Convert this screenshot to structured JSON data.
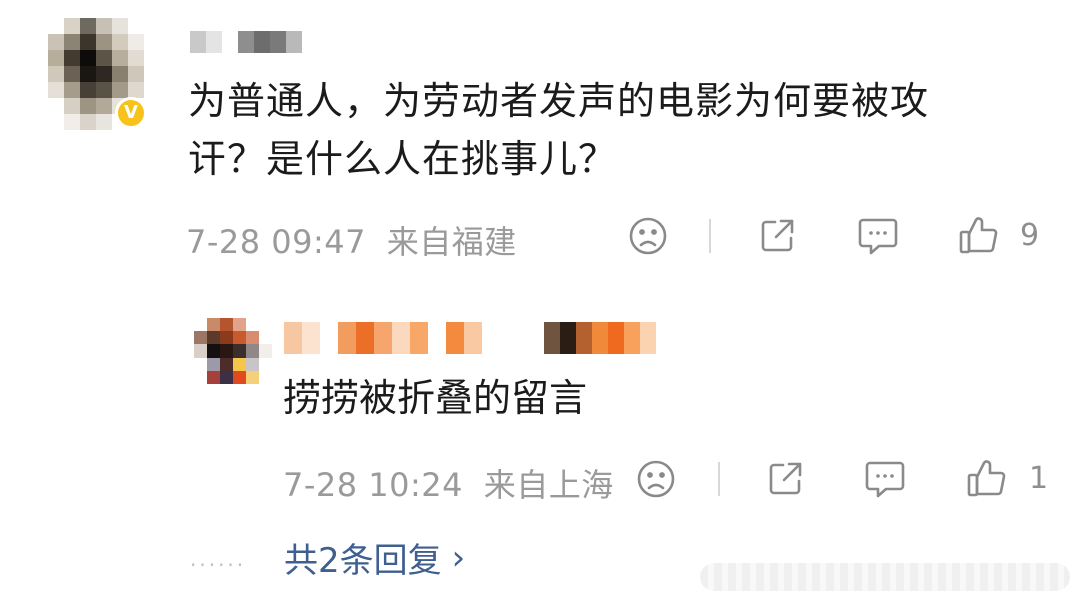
{
  "comment": {
    "text_line1": "为普通人，为劳动者发声的电影为何要被攻",
    "text_line2": "讦？是什么人在挑事儿？",
    "timestamp": "7-28 09:47",
    "location": "来自福建",
    "like_count": "9"
  },
  "reply": {
    "text": "捞捞被折叠的留言",
    "timestamp": "7-28 10:24",
    "location": "来自上海",
    "like_count": "1"
  },
  "more_replies": {
    "label": "共2条回复",
    "chevron": "›",
    "dots": "······"
  },
  "icons": {
    "dislike": "sad-face-icon",
    "share": "share-icon",
    "comment": "comment-icon",
    "like": "thumbs-up-icon",
    "verified": "verified-v-icon",
    "verified_glyph": "V"
  },
  "colors": {
    "text": "#1b1b1b",
    "meta": "#9a9a9a",
    "link": "#3f5f8f",
    "verified": "#f7c21a"
  }
}
